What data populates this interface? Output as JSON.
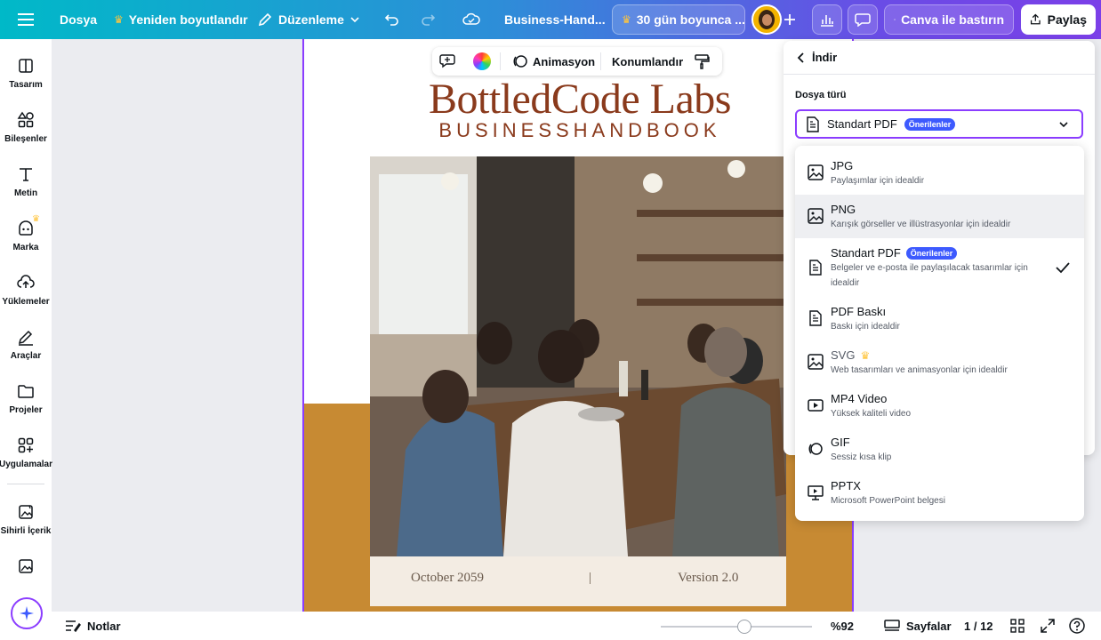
{
  "topbar": {
    "menu_label": "Dosya",
    "resize_label": "Yeniden boyutlandır",
    "edit_label": "Düzenleme",
    "doc_name": "Business-Hand...",
    "trial_label": "30 gün boyunca ...",
    "print_label": "Canva ile bastırın",
    "share_label": "Paylaş"
  },
  "sidebar": {
    "items": [
      {
        "label": "Tasarım",
        "icon": "layout-icon"
      },
      {
        "label": "Bileşenler",
        "icon": "elements-icon"
      },
      {
        "label": "Metin",
        "icon": "text-icon"
      },
      {
        "label": "Marka",
        "icon": "brand-icon"
      },
      {
        "label": "Yüklemeler",
        "icon": "upload-icon"
      },
      {
        "label": "Araçlar",
        "icon": "draw-icon"
      },
      {
        "label": "Projeler",
        "icon": "folder-icon"
      },
      {
        "label": "Uygulamalar",
        "icon": "apps-icon"
      },
      {
        "label": "Sihirli İçerik",
        "icon": "magic-media-icon"
      }
    ]
  },
  "float_toolbar": {
    "animate_label": "Animasyon",
    "position_label": "Konumlandır"
  },
  "document": {
    "title": "BottledCode Labs",
    "subtitle": "BUSINESSHANDBOOK",
    "date": "October 2059",
    "separator": "|",
    "version": "Version 2.0"
  },
  "panel": {
    "back_label": "İndir",
    "file_type_label": "Dosya türü",
    "selected": "Standart PDF",
    "selected_badge": "Önerilenler"
  },
  "dropdown": {
    "options": [
      {
        "title": "JPG",
        "desc": "Paylaşımlar için idealdir"
      },
      {
        "title": "PNG",
        "desc": "Karışık görseller ve illüstrasyonlar için idealdir"
      },
      {
        "title": "Standart PDF",
        "badge": "Önerilenler",
        "desc": "Belgeler ve e-posta ile paylaşılacak tasarımlar için idealdir"
      },
      {
        "title": "PDF Baskı",
        "desc": "Baskı için idealdir"
      },
      {
        "title": "SVG",
        "desc": "Web tasarımları ve animasyonlar için idealdir"
      },
      {
        "title": "MP4 Video",
        "desc": "Yüksek kaliteli video"
      },
      {
        "title": "GIF",
        "desc": "Sessiz kısa klip"
      },
      {
        "title": "PPTX",
        "desc": "Microsoft PowerPoint belgesi"
      }
    ]
  },
  "bottombar": {
    "notes_label": "Notlar",
    "zoom": "%92",
    "pages_label": "Sayfalar",
    "page_count": "1 / 12"
  },
  "colors": {
    "accent": "#8b3dff",
    "brand_brown": "#8a3a1c",
    "page_gold": "#c78a33"
  }
}
